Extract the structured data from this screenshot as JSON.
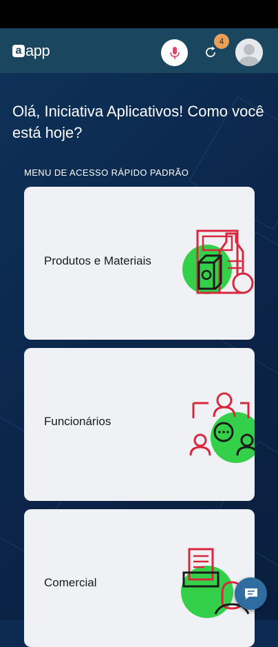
{
  "header": {
    "logo_text": "app",
    "logo_mark": "a",
    "mic_icon": "microphone-icon",
    "sync_icon": "sync-icon",
    "sync_badge": "4",
    "avatar_icon": "user-avatar"
  },
  "greeting": "Olá, Iniciativa Aplicativos! Como você está hoje?",
  "section_title": "MENU DE ACESSO RÁPIDO PADRÃO",
  "cards": [
    {
      "label": "Produtos e Materiais",
      "icon": "products-materials-icon"
    },
    {
      "label": "Funcionários",
      "icon": "employees-icon"
    },
    {
      "label": "Comercial",
      "icon": "commercial-icon"
    }
  ],
  "colors": {
    "accent_green": "#34d04a",
    "icon_red": "#d9263d",
    "badge": "#e9a15a",
    "chat_button": "#2f6da0"
  },
  "chat_icon": "chat-icon"
}
